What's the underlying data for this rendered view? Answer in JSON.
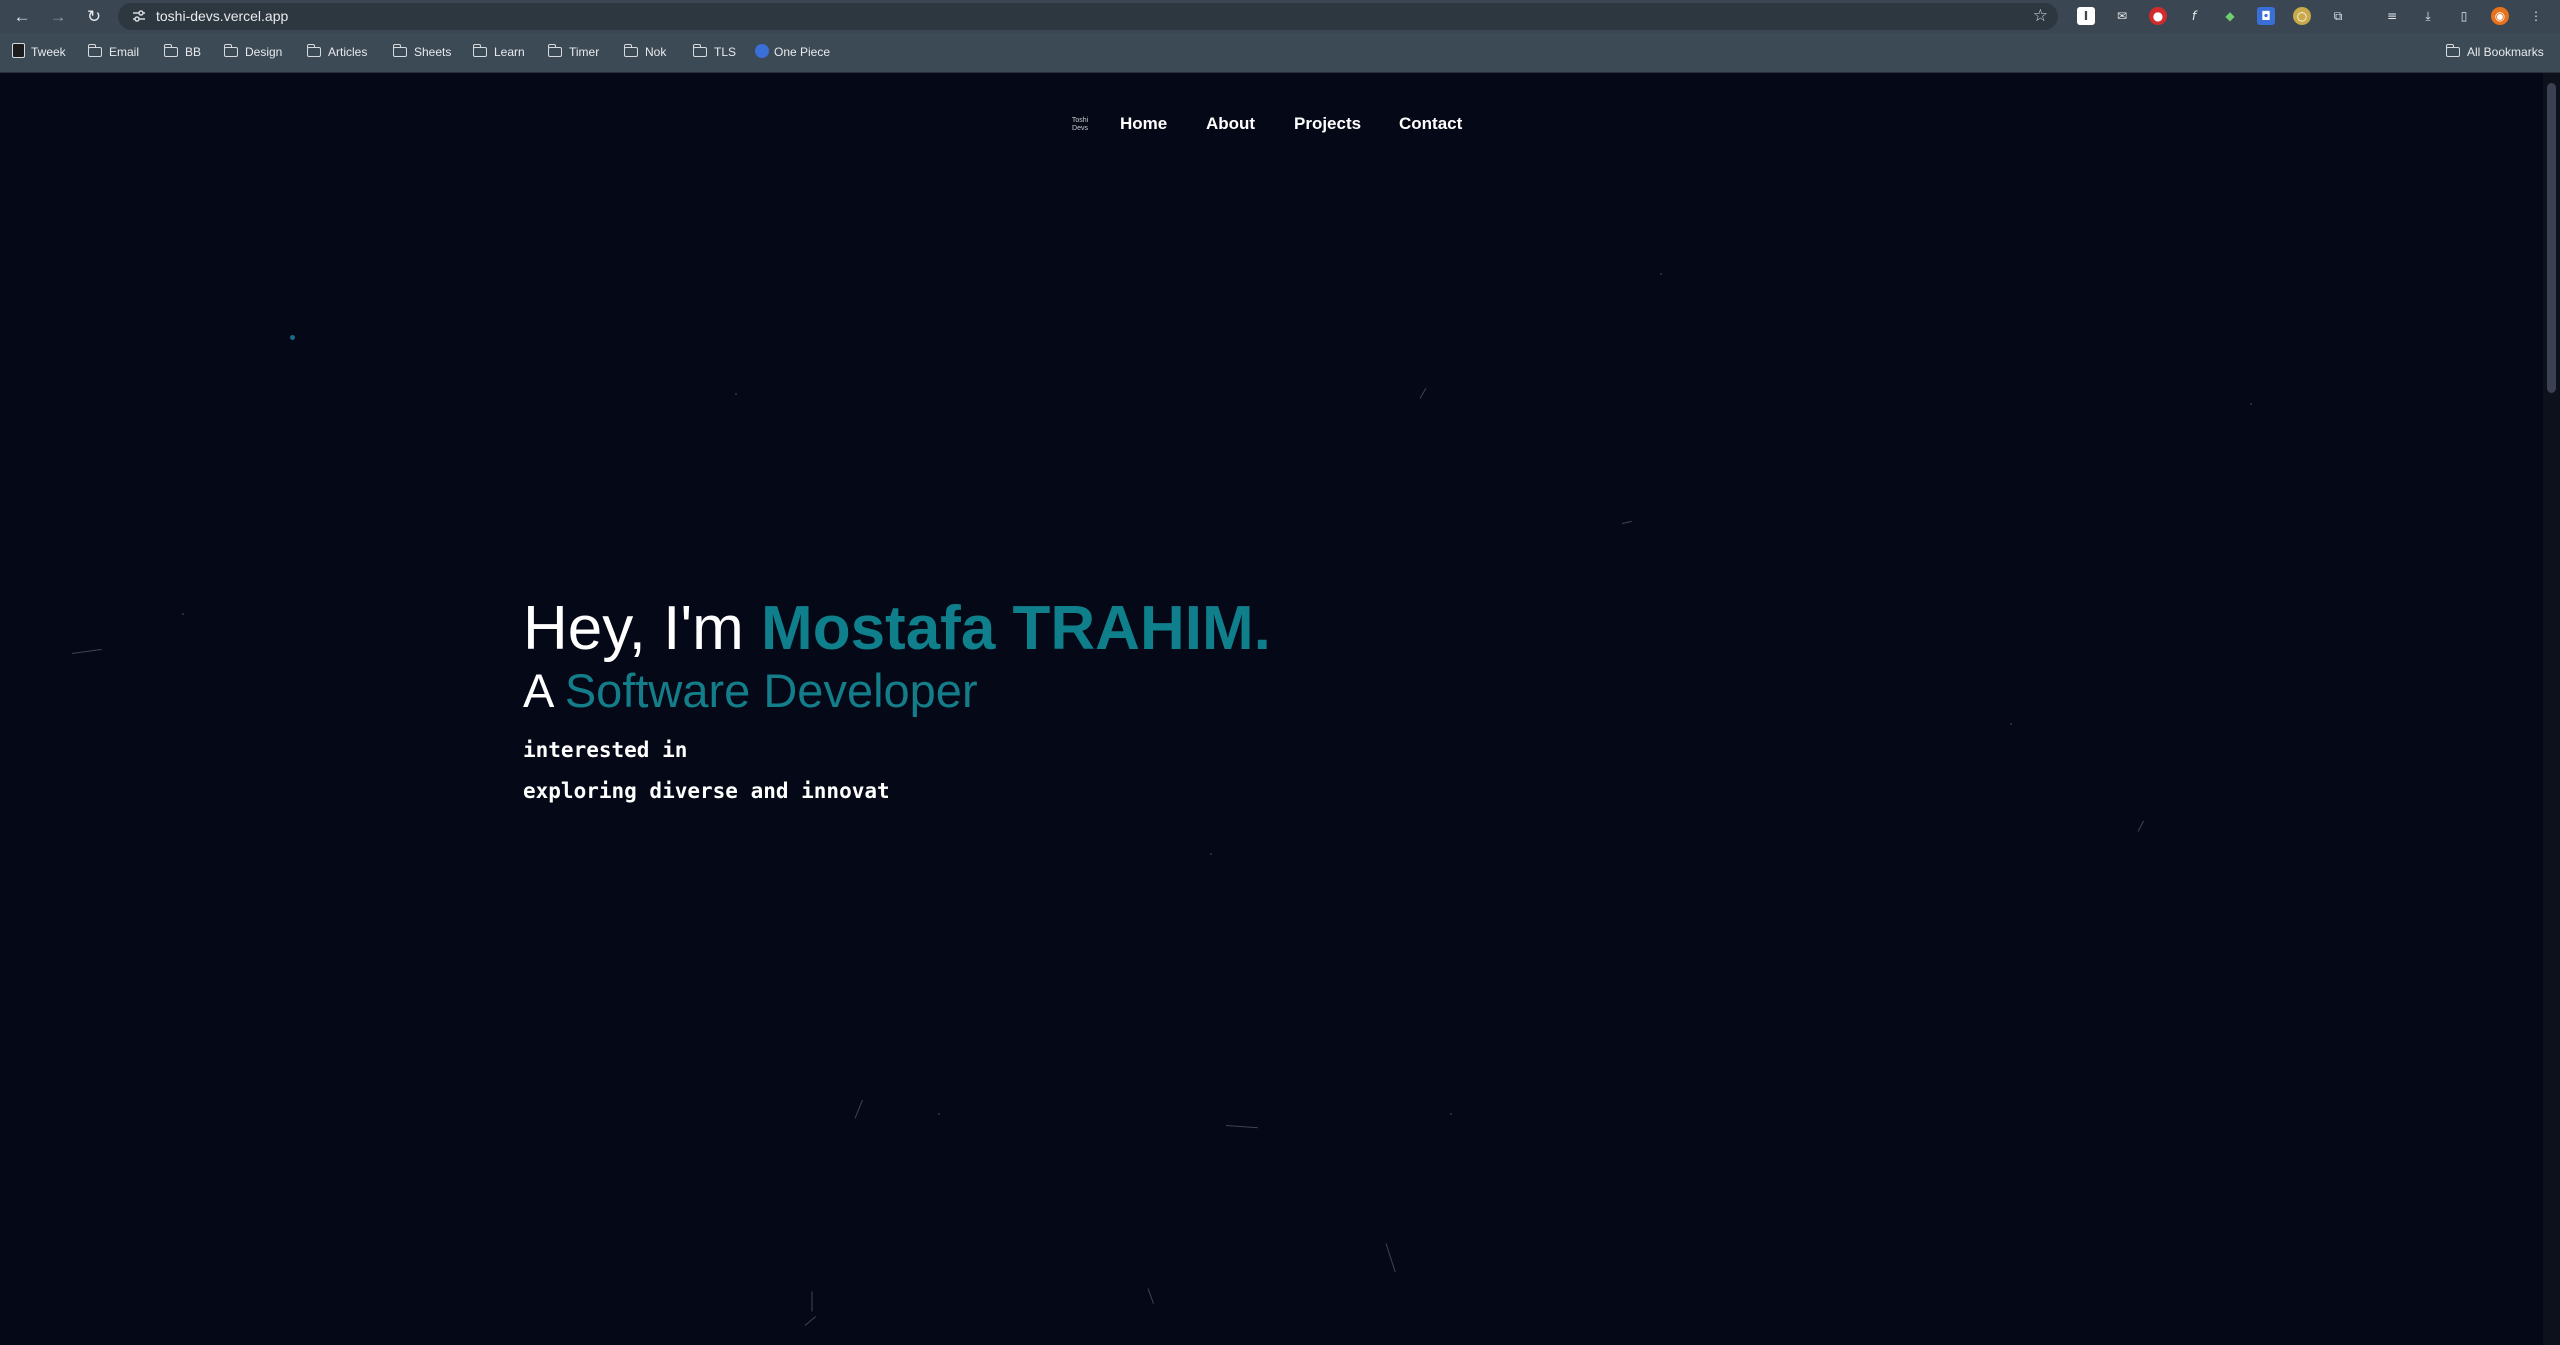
{
  "browser": {
    "url": "toshi-devs.vercel.app",
    "bookmarks": [
      "Tweek",
      "Email",
      "BB",
      "Design",
      "Articles",
      "Sheets",
      "Learn",
      "Timer",
      "Nok",
      "TLS",
      "One Piece"
    ],
    "all_bookmarks_label": "All Bookmarks"
  },
  "site": {
    "logo_text": "Toshi Devs",
    "nav": [
      "Home",
      "About",
      "Projects",
      "Contact"
    ]
  },
  "hero": {
    "greeting": "Hey, I'm ",
    "name": "Mostafa TRAHIM.",
    "role_prefix": "A ",
    "role": "Software Developer",
    "line1": "interested in",
    "line2": "exploring diverse and innovat"
  },
  "colors": {
    "background": "#050816",
    "accent": "#0f7f8c",
    "chrome": "#3c4a56"
  }
}
